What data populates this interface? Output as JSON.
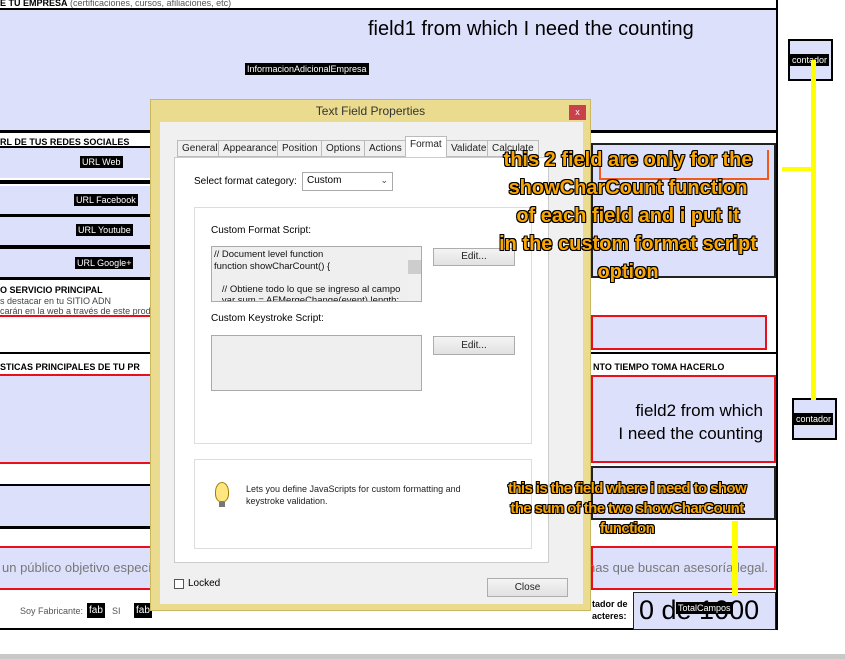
{
  "form": {
    "section_company_bold": "E TU EMPRESA",
    "section_company_note": "(certificaciones, cursos, afiliaciones, etc)",
    "field1_text": "field1 from which I need the counting",
    "field1_name": "InformacionAdicionalEmpresa",
    "section_social": "RL DE TUS REDES SOCIALES",
    "url_tags": [
      "URL Web",
      "URL Facebook",
      "URL Youtube",
      "URL Google+"
    ],
    "section_service": "O SERVICIO PRINCIPAL",
    "service_line1": "s destacar en tu SITIO ADN",
    "service_line2": "carán en la web a través de este produ",
    "section_features": "STICAS PRINCIPALES DE TU PR",
    "section_time": "NTO TIEMPO TOMA HACERLO",
    "field2_line1": "field2 from which",
    "field2_line2": "I need the counting",
    "audience_left": "un público objetivo específic",
    "audience_right": "onas que buscan asesoría legal.",
    "fabricante_label": "Soy Fabricante:",
    "fab_tag": "fab",
    "si_label": "SI",
    "counter_label_1": "tador de",
    "counter_label_2": "acteres:",
    "counter_value": "0 de 1000",
    "total_field_name": "TotalCampos",
    "contador_tag": "contador"
  },
  "dialog": {
    "title": "Text Field Properties",
    "close_x": "x",
    "tabs": [
      "General",
      "Appearance",
      "Position",
      "Options",
      "Actions",
      "Format",
      "Validate",
      "Calculate"
    ],
    "active_tab": "Format",
    "format_category_label": "Select format category:",
    "format_category_value": "Custom",
    "custom_format_label": "Custom Format Script:",
    "custom_format_script": "// Document level function\nfunction showCharCount() {\n\n   // Obtiene todo lo que se ingreso al campo\n   var sum = AFMergeChange(event).length;",
    "edit_label": "Edit...",
    "custom_keystroke_label": "Custom Keystroke Script:",
    "info_text": "Lets you define JavaScripts for custom formatting and keystroke validation.",
    "locked_label": "Locked",
    "close_label": "Close"
  },
  "annotations": {
    "top": [
      "this 2 field are only for the",
      "showCharCount function",
      "of each field and i put it",
      "in the custom format script",
      "option"
    ],
    "bottom": [
      "this is the field where i need to show",
      "the sum of the two showCharCount",
      "function"
    ],
    "color": "#f9a602"
  }
}
